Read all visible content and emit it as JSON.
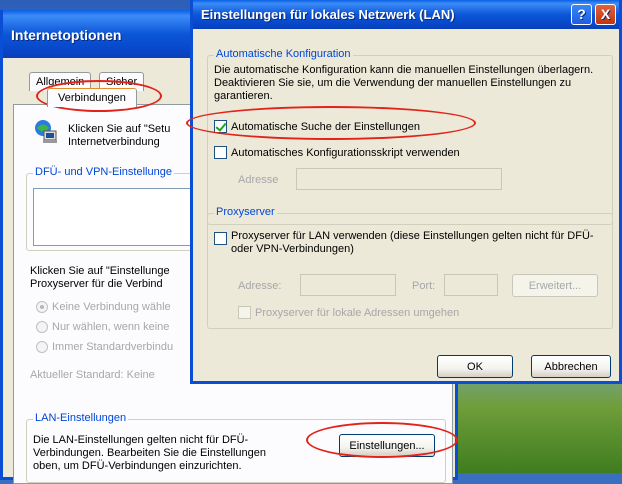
{
  "background_window": {
    "title": "Internetoptionen",
    "tabs": [
      "Allgemein",
      "Sicher",
      "Verbindungen"
    ],
    "connect_text": "Klicken Sie auf \"Setu\nInternetverbindung",
    "dfu_group_label": "DFÜ- und VPN-Einstellunge",
    "proxy_hint": "Klicken Sie auf \"Einstellunge\nProxyserver für die Verbind",
    "radios": [
      "Keine Verbindung wähle",
      "Nur wählen, wenn keine",
      "Immer Standardverbindu"
    ],
    "current_default": "Aktueller Standard:  Keine",
    "lan_group_label": "LAN-Einstellungen",
    "lan_text": "Die LAN-Einstellungen gelten nicht für DFÜ-\nVerbindungen. Bearbeiten Sie die Einstellungen\noben, um DFÜ-Verbindungen einzurichten.",
    "settings_button": "Einstellungen..."
  },
  "lan_dialog": {
    "title": "Einstellungen für lokales Netzwerk (LAN)",
    "help_button": "?",
    "close_button": "X",
    "auto_group_label": "Automatische Konfiguration",
    "auto_description": "Die automatische Konfiguration kann die manuellen Einstellungen überlagern. Deaktivieren Sie sie, um die Verwendung der manuellen Einstellungen zu garantieren.",
    "auto_detect_label": "Automatische Suche der Einstellungen",
    "auto_detect_checked": true,
    "script_label": "Automatisches Konfigurationsskript verwenden",
    "script_checked": false,
    "address_label": "Adresse",
    "proxy_group_label": "Proxyserver",
    "proxy_label": "Proxyserver für LAN verwenden (diese Einstellungen gelten nicht für DFÜ- oder VPN-Verbindungen)",
    "proxy_checked": false,
    "proxy_address_label": "Adresse:",
    "proxy_port_label": "Port:",
    "advanced_button": "Erweitert...",
    "bypass_label": "Proxyserver für lokale Adressen umgehen",
    "ok_button": "OK",
    "cancel_button": "Abbrechen"
  },
  "colors": {
    "title_blue": "#0a4ed6",
    "annotation_red": "#e2231a",
    "group_label_blue": "#0046d5"
  }
}
